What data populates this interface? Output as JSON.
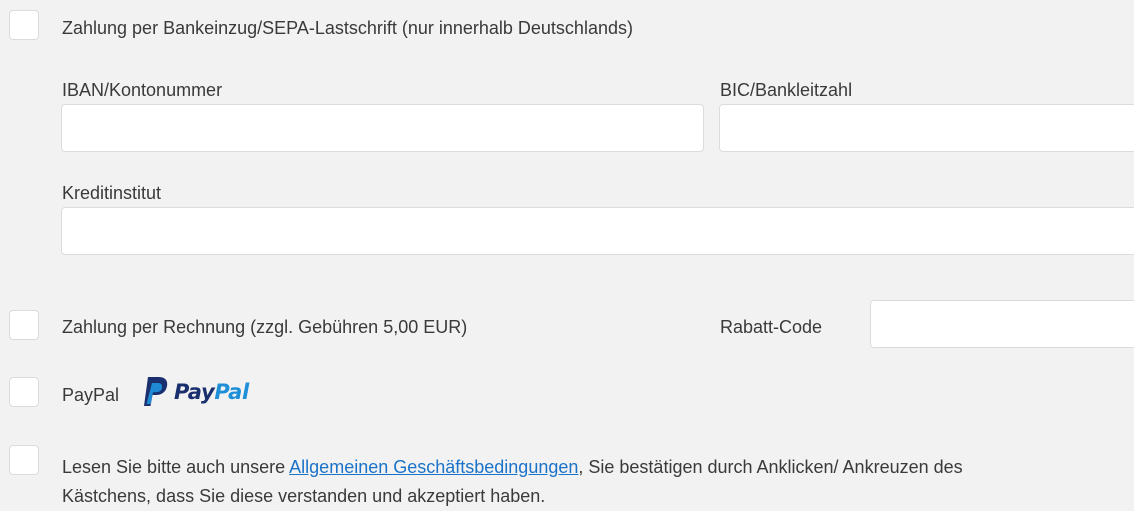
{
  "sepa": {
    "label": "Zahlung per Bankeinzug/SEPA-Lastschrift (nur innerhalb Deutschlands)",
    "iban_label": "IBAN/Kontonummer",
    "iban_value": "",
    "bic_label": "BIC/Bankleitzahl",
    "bic_value": "",
    "bank_label": "Kreditinstitut",
    "bank_value": ""
  },
  "invoice": {
    "label": "Zahlung per Rechnung (zzgl. Gebühren 5,00 EUR)",
    "discount_label": "Rabatt-Code",
    "discount_value": ""
  },
  "paypal": {
    "label": "PayPal",
    "logo_text_pay": "Pay",
    "logo_text_pal": "Pal",
    "logo_colors": {
      "dark": "#1a2f6e",
      "light": "#1f8fd8"
    }
  },
  "terms": {
    "text_before": "Lesen Sie bitte auch unsere ",
    "link_text": "Allgemeinen Geschäftsbedingungen",
    "text_after": ", Sie bestätigen durch Anklicken/ Ankreuzen des Kästchens, dass Sie diese verstanden und akzeptiert haben."
  },
  "colors": {
    "background": "#f2f2f2",
    "link": "#1a73c9",
    "text": "#3a3a3a"
  }
}
